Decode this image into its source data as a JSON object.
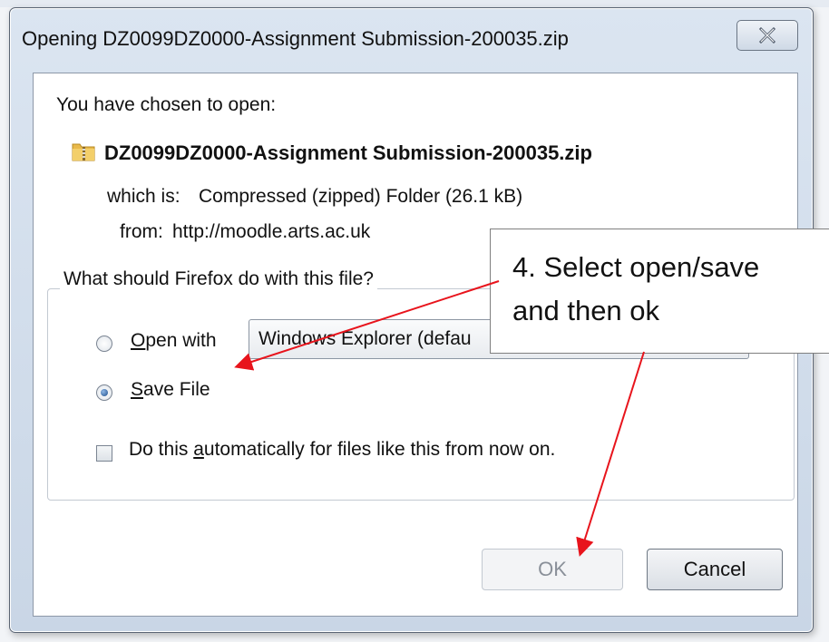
{
  "window": {
    "title": "Opening DZ0099DZ0000-Assignment Submission-200035.zip"
  },
  "dialog": {
    "intro": "You have chosen to open:",
    "file_name": "DZ0099DZ0000-Assignment Submission-200035.zip",
    "which_label": "which is:",
    "which_value": "Compressed (zipped) Folder (26.1 kB)",
    "from_label": "from:",
    "from_value": "http://moodle.arts.ac.uk",
    "question": "What should Firefox do with this file?",
    "open_with": {
      "mnemonic": "O",
      "rest": "pen with",
      "selected": false
    },
    "open_with_app": "Windows Explorer (defau",
    "save_file": {
      "mnemonic": "S",
      "rest": "ave File",
      "selected": true
    },
    "auto": {
      "before": "Do this ",
      "mnemonic": "a",
      "after": "utomatically for files like this from now on.",
      "checked": false
    }
  },
  "buttons": {
    "ok_label": "OK",
    "cancel_label": "Cancel"
  },
  "annotation": {
    "line1": "4. Select open/save",
    "line2": "and then ok",
    "arrow_color": "#e8141c"
  },
  "icons": {
    "close": "close-icon",
    "file": "zip-folder-icon"
  }
}
